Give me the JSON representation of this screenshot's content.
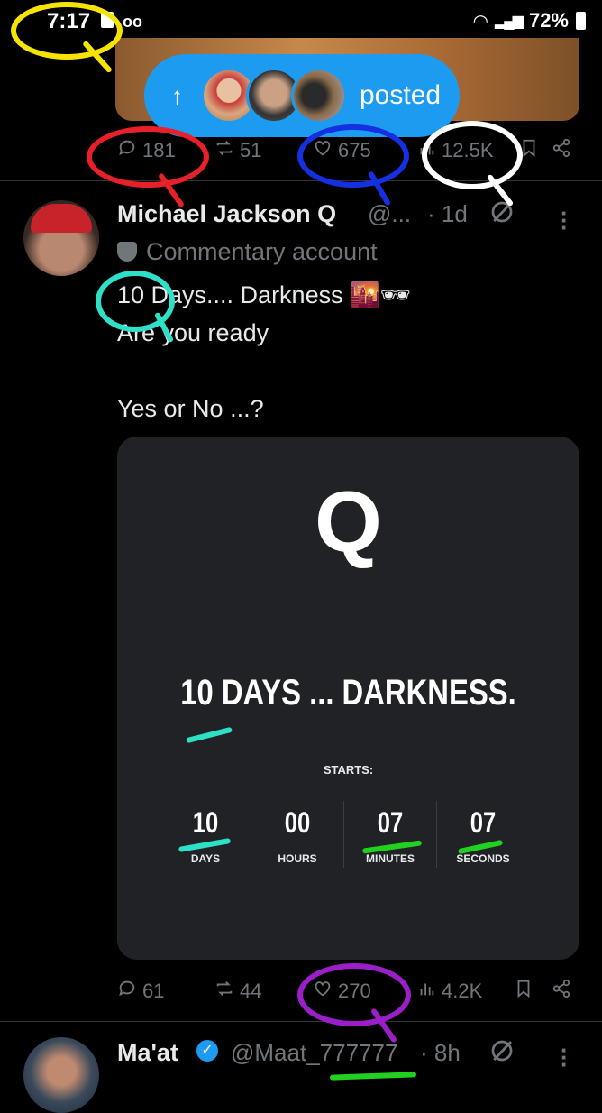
{
  "status_bar": {
    "time": "7:17",
    "battery": "72%"
  },
  "prev_tweet": {
    "posted_label": "posted",
    "stats": {
      "replies": "181",
      "reposts": "51",
      "likes": "675",
      "views": "12.5K"
    }
  },
  "tweet": {
    "name": "Michael Jackson Q",
    "handle": "@...",
    "time": "· 1d",
    "label": "Commentary account",
    "text": "10 Days.... Darkness 🌇🕶\nAre you ready\n\nYes or No ...?",
    "card": {
      "logo": "Q",
      "headline": "10 DAYS ... DARKNESS.",
      "starts_label": "STARTS:",
      "countdown": [
        {
          "value": "10",
          "label": "DAYS"
        },
        {
          "value": "00",
          "label": "HOURS"
        },
        {
          "value": "07",
          "label": "MINUTES"
        },
        {
          "value": "07",
          "label": "SECONDS"
        }
      ]
    },
    "stats": {
      "replies": "61",
      "reposts": "44",
      "likes": "270",
      "views": "4.2K"
    }
  },
  "next_tweet": {
    "name": "Ma'at",
    "handle": "@Maat_777777",
    "time": "· 8h"
  },
  "annotation_colors": {
    "yellow": "#f5e400",
    "red": "#e8202a",
    "blue": "#1430e0",
    "white": "#ffffff",
    "teal": "#2fe0c8",
    "green": "#22d020",
    "purple": "#9b1fc8"
  }
}
